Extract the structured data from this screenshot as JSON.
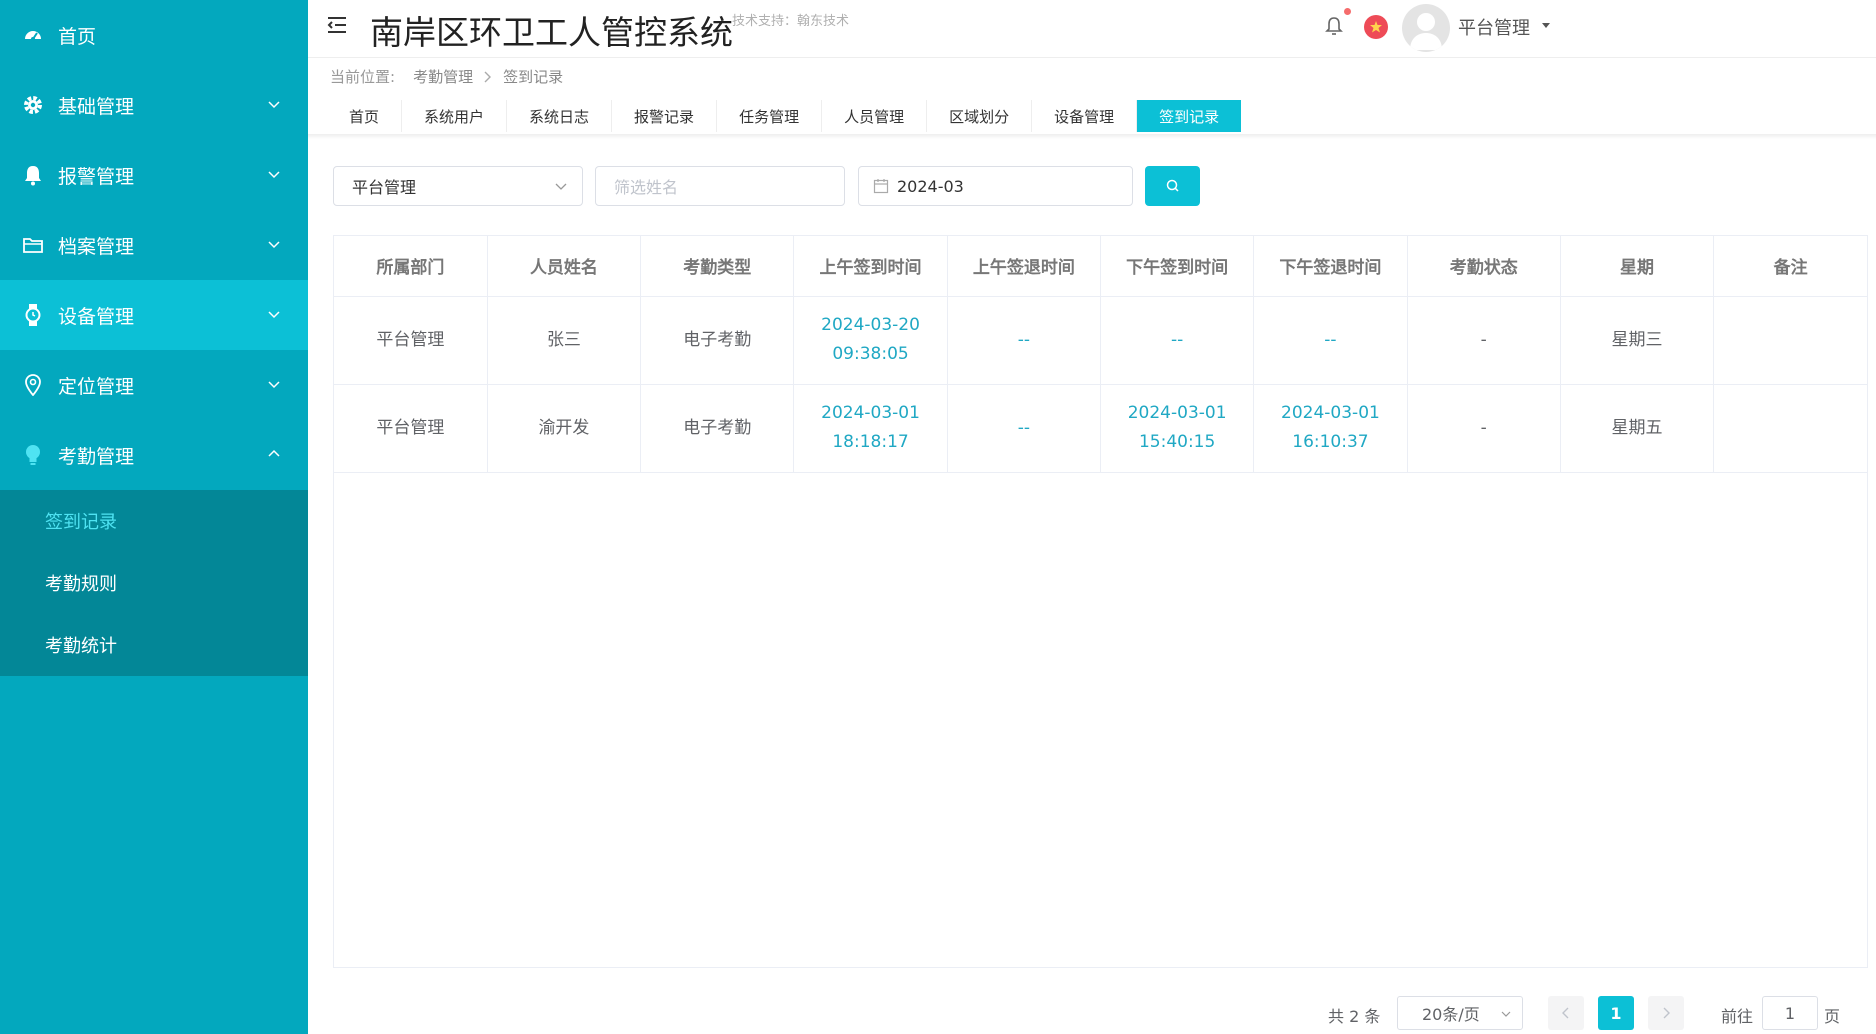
{
  "sidebar": {
    "home": {
      "label": "首页",
      "icon": "dashboard-icon"
    },
    "groups": [
      {
        "label": "基础管理",
        "icon": "gear-icon"
      },
      {
        "label": "报警管理",
        "icon": "bell-icon"
      },
      {
        "label": "档案管理",
        "icon": "folder-icon"
      },
      {
        "label": "设备管理",
        "icon": "watch-icon"
      },
      {
        "label": "定位管理",
        "icon": "location-pin-icon"
      },
      {
        "label": "考勤管理",
        "icon": "lightbulb-icon"
      }
    ],
    "attendance_submenu": [
      {
        "label": "签到记录"
      },
      {
        "label": "考勤规则"
      },
      {
        "label": "考勤统计"
      }
    ],
    "colors": {
      "bg": "#03a8be",
      "highlight": "#0cc0d6",
      "submenu_bg": "#038797",
      "current_sub": "#4fe3f2"
    }
  },
  "header": {
    "title": "南岸区环卫工人管控系统",
    "tech_support": "技术支持：翰东技术",
    "user_name": "平台管理"
  },
  "breadcrumb": {
    "prefix": "当前位置:",
    "items": [
      "考勤管理",
      "签到记录"
    ]
  },
  "tabs": [
    {
      "label": "首页"
    },
    {
      "label": "系统用户"
    },
    {
      "label": "系统日志"
    },
    {
      "label": "报警记录"
    },
    {
      "label": "任务管理"
    },
    {
      "label": "人员管理"
    },
    {
      "label": "区域划分"
    },
    {
      "label": "设备管理"
    },
    {
      "label": "签到记录",
      "active": true
    }
  ],
  "filters": {
    "department": "平台管理",
    "name_placeholder": "筛选姓名",
    "month": "2024-03"
  },
  "table": {
    "columns": [
      "所属部门",
      "人员姓名",
      "考勤类型",
      "上午签到时间",
      "上午签退时间",
      "下午签到时间",
      "下午签退时间",
      "考勤状态",
      "星期",
      "备注"
    ],
    "rows": [
      [
        "平台管理",
        "张三",
        "电子考勤",
        "2024-03-20 09:38:05",
        "--",
        "--",
        "--",
        "-",
        "星期三",
        ""
      ],
      [
        "平台管理",
        "渝开发",
        "电子考勤",
        "2024-03-01 18:18:17",
        "--",
        "2024-03-01 15:40:15",
        "2024-03-01 16:10:37",
        "-",
        "星期五",
        ""
      ]
    ]
  },
  "pagination": {
    "total": "共 2 条",
    "page_size": "20条/页",
    "current_page": "1",
    "goto_label": "前往",
    "goto_value": "1",
    "goto_unit": "页"
  },
  "accent": "#0cc0d6"
}
